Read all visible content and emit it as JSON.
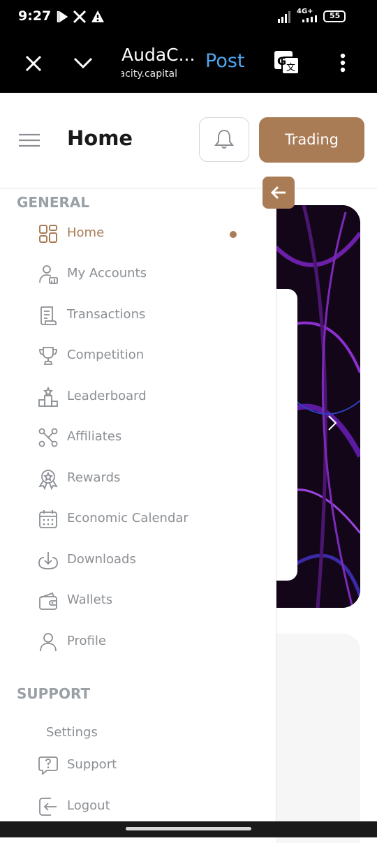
{
  "status_bar": {
    "time": "9:27",
    "network": "4G+",
    "battery": "55"
  },
  "browser": {
    "title": "AudaC...",
    "url": "audacity.capital",
    "post_label": "Post"
  },
  "header": {
    "page_title": "Home",
    "trading_label": "Trading"
  },
  "sidebar": {
    "general_heading": "GENERAL",
    "items": [
      {
        "label": "Home",
        "icon": "grid-icon",
        "active": true
      },
      {
        "label": "My Accounts",
        "icon": "user-accounts-icon"
      },
      {
        "label": "Transactions",
        "icon": "receipt-icon"
      },
      {
        "label": "Competition",
        "icon": "trophy-icon"
      },
      {
        "label": "Leaderboard",
        "icon": "podium-icon"
      },
      {
        "label": "Affiliates",
        "icon": "share-network-icon"
      },
      {
        "label": "Rewards",
        "icon": "award-icon"
      },
      {
        "label": "Economic Calendar",
        "icon": "calendar-icon"
      },
      {
        "label": "Downloads",
        "icon": "download-icon"
      },
      {
        "label": "Wallets",
        "icon": "wallet-icon"
      },
      {
        "label": "Profile",
        "icon": "profile-icon"
      }
    ],
    "support_heading": "SUPPORT",
    "settings_label": "Settings",
    "support_items": [
      {
        "label": "Support",
        "icon": "help-chat-icon"
      },
      {
        "label": "Logout",
        "icon": "logout-icon"
      }
    ]
  },
  "colors": {
    "accent": "#a97c56",
    "muted": "#8b8f94",
    "heading": "#9aa0a6",
    "link": "#4fa6f0"
  }
}
